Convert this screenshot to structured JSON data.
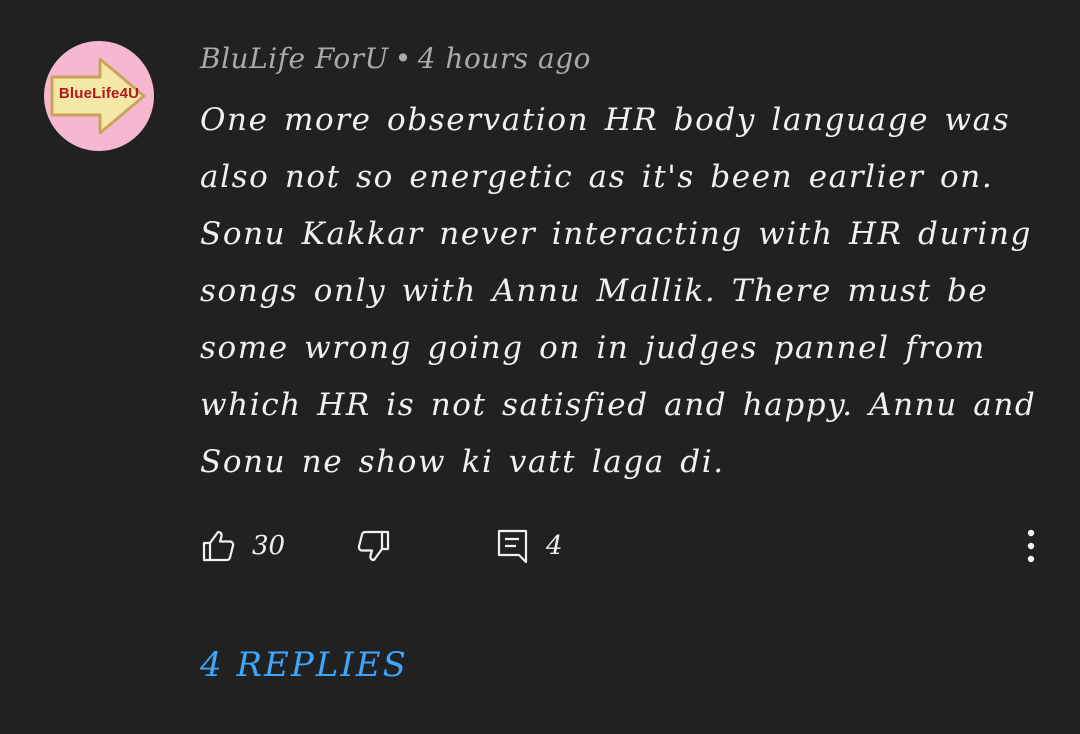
{
  "comment": {
    "author_avatar_text": "BlueLife4U",
    "author": "BluLife ForU",
    "separator": "•",
    "time": "4 hours ago",
    "text": "One more observation HR body language was also not so energetic as it's been earlier on. Sonu Kakkar never interacting with HR during songs only with Annu Mallik. There must be some wrong going on in judges pannel from which HR is not satisfied and happy. Annu and Sonu ne show ki vatt laga di."
  },
  "actions": {
    "like_icon": "thumbs-up-icon",
    "like_count": "30",
    "dislike_icon": "thumbs-down-icon",
    "reply_icon": "reply-icon",
    "reply_count": "4",
    "more_icon": "more-vertical-icon"
  },
  "replies": {
    "label": "4 REPLIES"
  },
  "colors": {
    "background": "#212121",
    "text": "#f1f1f1",
    "meta": "#aaaaaa",
    "link": "#3ea6ff",
    "avatar_bg": "#f6b8d1",
    "avatar_arrow": "#f3e8a6",
    "avatar_text": "#b3171b"
  }
}
